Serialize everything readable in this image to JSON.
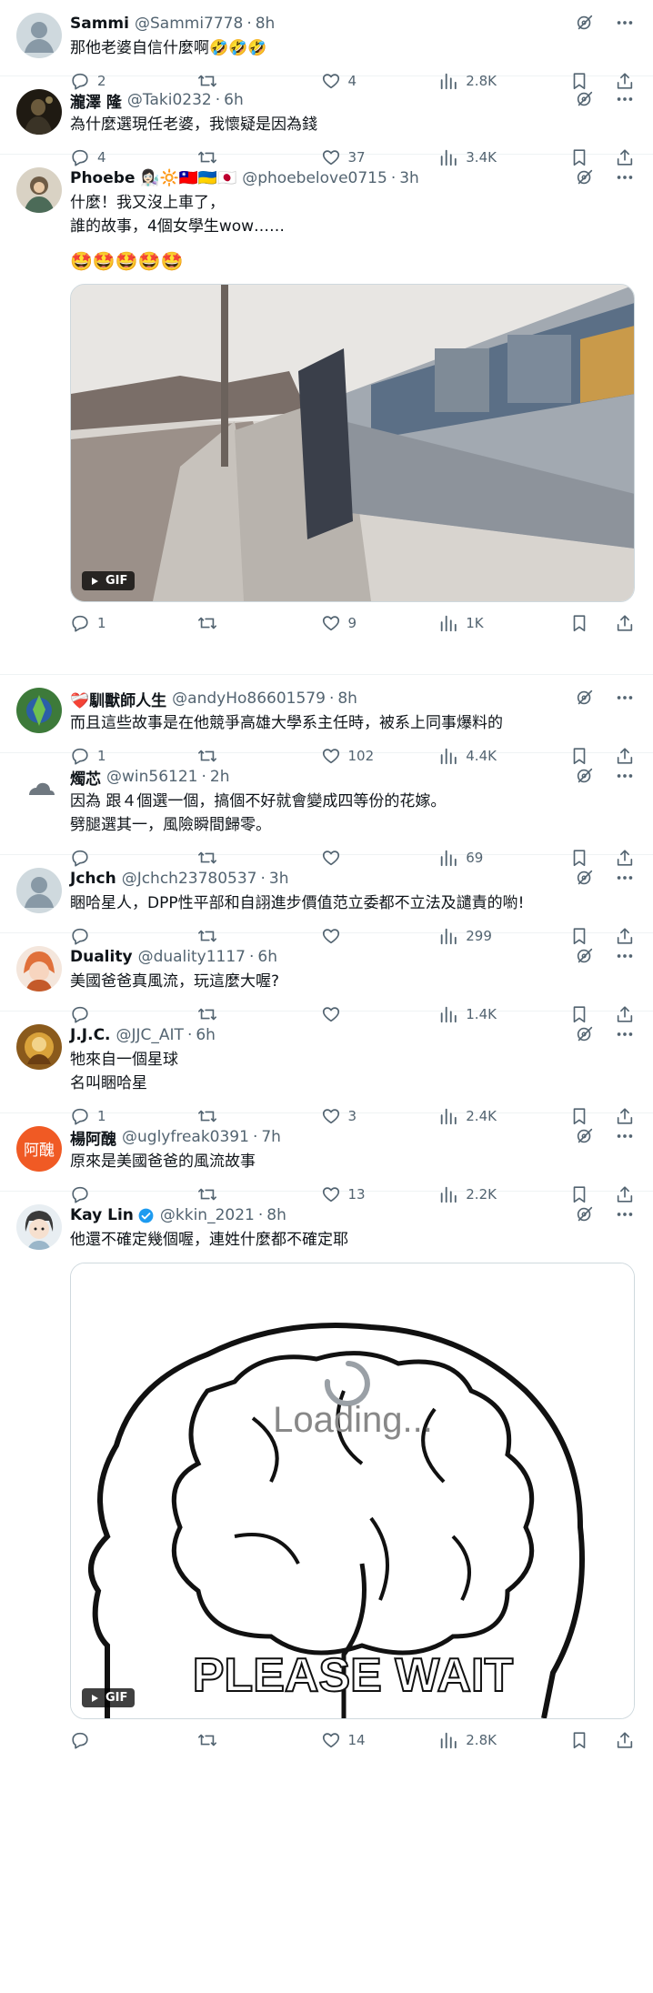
{
  "tweets": [
    {
      "name": "Sammi",
      "handle": "@Sammi7778",
      "time": "8h",
      "text": "那他老婆自信什麼啊🤣🤣🤣",
      "replies": "2",
      "retweets": "",
      "likes": "4",
      "views": "2.8K",
      "avatar": "default-avatar"
    },
    {
      "name": "瀧澤 隆",
      "handle": "@Taki0232",
      "time": "6h",
      "text": "為什麼選現任老婆，我懷疑是因為錢",
      "replies": "4",
      "retweets": "",
      "likes": "37",
      "views": "3.4K",
      "avatar": "dark-photo-avatar"
    },
    {
      "name": "Phoebe 👩🏻‍🔬🔆🇹🇼🇺🇦🇯🇵",
      "handle": "@phoebelove0715",
      "time": "3h",
      "text": "什麼！我又沒上車了，\n誰的故事，4個女學生wow……",
      "extra": "🤩🤩🤩🤩🤩",
      "gif_label": "GIF",
      "replies": "1",
      "retweets": "",
      "likes": "9",
      "views": "1K",
      "avatar": "photo-avatar"
    },
    {
      "name": "❤️‍🩹馴獸師人生",
      "handle": "@andyHo86601579",
      "time": "8h",
      "text": "而且這些故事是在他競爭高雄大學系主任時，被系上同事爆料的",
      "replies": "1",
      "retweets": "",
      "likes": "102",
      "views": "4.4K",
      "avatar": "green-avatar"
    },
    {
      "name": "燭芯",
      "handle": "@win56121",
      "time": "2h",
      "text": "因為 跟４個選一個，搞個不好就會變成四等份的花嫁。\n劈腿選其一，風險瞬間歸零。",
      "replies": "",
      "retweets": "",
      "likes": "",
      "views": "69",
      "avatar": "cloud-avatar"
    },
    {
      "name": "Jchch",
      "handle": "@Jchch23780537",
      "time": "3h",
      "text": "睏哈星人，DPP性平部和自詡進步價值范立委都不立法及譴責的喲!",
      "replies": "",
      "retweets": "",
      "likes": "",
      "views": "299",
      "avatar": "default-avatar"
    },
    {
      "name": "Duality",
      "handle": "@duality1117",
      "time": "6h",
      "text": "美國爸爸真風流，玩這麼大喔?",
      "replies": "",
      "retweets": "",
      "likes": "",
      "views": "1.4K",
      "avatar": "anime-avatar"
    },
    {
      "name": "J.J.C.",
      "handle": "@JJC_AIT",
      "time": "6h",
      "text": "牠來自一個星球\n名叫睏哈星",
      "replies": "1",
      "retweets": "",
      "likes": "3",
      "views": "2.4K",
      "avatar": "golden-avatar"
    },
    {
      "name": "楊阿醜",
      "handle": "@uglyfreak0391",
      "time": "7h",
      "text": "原來是美國爸爸的風流故事",
      "avatar_text": "阿醜",
      "replies": "",
      "retweets": "",
      "likes": "13",
      "views": "2.2K",
      "avatar": "orange-text-avatar"
    },
    {
      "name": "Kay Lin",
      "handle": "@kkin_2021",
      "time": "8h",
      "text": "他還不確定幾個喔，連姓什麼都不確定耶",
      "gif_label": "GIF",
      "gif_text_top": "Loading...",
      "gif_text_bottom": "PLEASE WAIT",
      "replies": "",
      "retweets": "",
      "likes": "14",
      "views": "2.8K",
      "avatar": "cartoon-girl-avatar",
      "verified": true
    }
  ],
  "colors": {
    "text": "#0f1419",
    "secondary": "#536471",
    "divider": "#eff3f4",
    "verified": "#1d9bf0"
  }
}
